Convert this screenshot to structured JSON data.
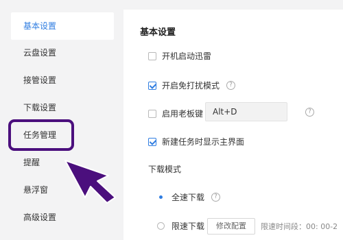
{
  "sidebar": {
    "items": [
      {
        "label": "基本设置",
        "active": true
      },
      {
        "label": "云盘设置",
        "active": false
      },
      {
        "label": "接管设置",
        "active": false
      },
      {
        "label": "下载设置",
        "active": false
      },
      {
        "label": "任务管理",
        "active": false
      },
      {
        "label": "提醒",
        "active": false
      },
      {
        "label": "悬浮窗",
        "active": false
      },
      {
        "label": "高级设置",
        "active": false
      }
    ]
  },
  "annotation": {
    "highlight_color": "#4b0f7d",
    "arrow_color": "#4b0f7d",
    "arrow_icon": "pointer-arrow-icon"
  },
  "main": {
    "section_title": "基本设置",
    "options": [
      {
        "label": "开机启动迅雷",
        "checked": false
      },
      {
        "label": "开启免打扰模式",
        "checked": true,
        "help_icon": "?"
      },
      {
        "label": "启用老板键",
        "checked": false,
        "help_icon": "?"
      },
      {
        "label": "新建任务时显示主界面",
        "checked": true
      }
    ],
    "boss_key_value": "Alt+D",
    "download_mode": {
      "title": "下载模式",
      "full_speed_label": "全速下载",
      "full_speed_selected": true,
      "limited_label": "限速下载",
      "limited_selected": false,
      "modify_button": "修改配置",
      "time_text": "限速时间段：00: 00-2"
    }
  },
  "colors": {
    "accent": "#2f7de1",
    "sidebar_bg": "#f3f3f4",
    "panel_bg": "#ffffff"
  }
}
